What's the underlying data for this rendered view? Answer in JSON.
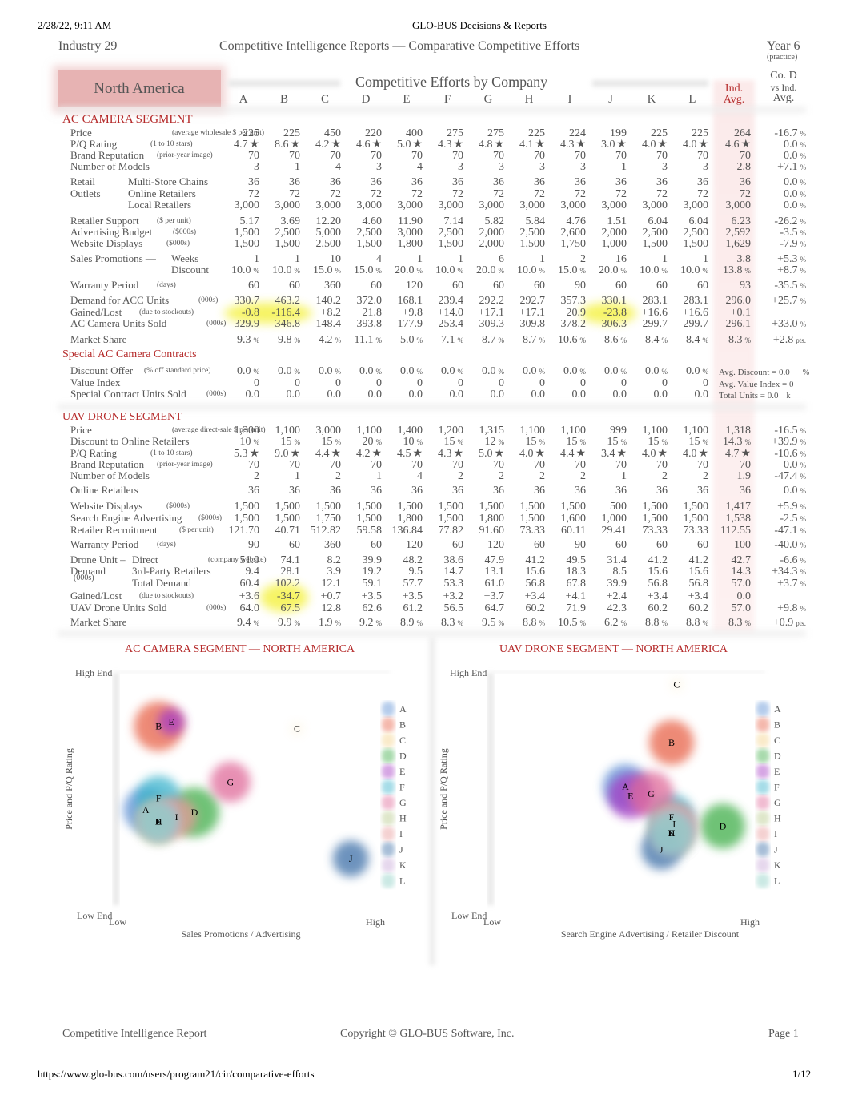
{
  "print_header": {
    "datetime": "2/28/22, 9:11 AM",
    "title": "GLO-BUS Decisions & Reports"
  },
  "report_header": {
    "industry": "Industry 29",
    "title": "Competitive Intelligence Reports — Comparative Competitive Efforts",
    "year": "Year 6",
    "year_note": "(practice)"
  },
  "region": "North America",
  "table_title": "Competitive Efforts by Company",
  "companies": [
    "A",
    "B",
    "C",
    "D",
    "E",
    "F",
    "G",
    "H",
    "I",
    "J",
    "K",
    "L"
  ],
  "avg_header": [
    "Ind.",
    "Avg."
  ],
  "diff_header": [
    "Co. D",
    "vs Ind.",
    "Avg."
  ],
  "ac_segment": {
    "title": "AC CAMERA SEGMENT",
    "rows": [
      {
        "label": "Price",
        "sub": "(average wholesale $ per unit)",
        "values": [
          "225",
          "225",
          "450",
          "220",
          "400",
          "275",
          "275",
          "225",
          "224",
          "199",
          "225",
          "225"
        ],
        "avg": "264",
        "diff": "-16.7",
        "diff_unit": "%"
      },
      {
        "label": "P/Q Rating",
        "sub": "(1 to 10 stars)",
        "values": [
          "4.7",
          "8.6",
          "4.2",
          "4.6",
          "5.0",
          "4.3",
          "4.8",
          "4.1",
          "4.3",
          "3.0",
          "4.0",
          "4.0"
        ],
        "value_suffix": "★",
        "avg": "4.6",
        "avg_suffix": "★",
        "diff": "0.0",
        "diff_unit": "%"
      },
      {
        "label": "Brand Reputation",
        "sub": "(prior-year image)",
        "values": [
          "70",
          "70",
          "70",
          "70",
          "70",
          "70",
          "70",
          "70",
          "70",
          "70",
          "70",
          "70"
        ],
        "avg": "70",
        "diff": "0.0",
        "diff_unit": "%"
      },
      {
        "label": "Number of Models",
        "sub": "",
        "values": [
          "3",
          "1",
          "4",
          "3",
          "4",
          "3",
          "3",
          "3",
          "3",
          "1",
          "3",
          "3"
        ],
        "avg": "2.8",
        "diff": "+7.1",
        "diff_unit": "%"
      },
      {
        "label": "Retail",
        "label2": "Multi-Store Chains",
        "values": [
          "36",
          "36",
          "36",
          "36",
          "36",
          "36",
          "36",
          "36",
          "36",
          "36",
          "36",
          "36"
        ],
        "avg": "36",
        "diff": "0.0",
        "diff_unit": "%"
      },
      {
        "label": "Outlets",
        "label2": "Online Retailers",
        "values": [
          "72",
          "72",
          "72",
          "72",
          "72",
          "72",
          "72",
          "72",
          "72",
          "72",
          "72",
          "72"
        ],
        "avg": "72",
        "diff": "0.0",
        "diff_unit": "%"
      },
      {
        "label": "",
        "label2": "Local Retailers",
        "values": [
          "3,000",
          "3,000",
          "3,000",
          "3,000",
          "3,000",
          "3,000",
          "3,000",
          "3,000",
          "3,000",
          "3,000",
          "3,000",
          "3,000"
        ],
        "avg": "3,000",
        "diff": "0.0",
        "diff_unit": "%"
      },
      {
        "label": "Retailer Support",
        "sub": "($ per unit)",
        "values": [
          "5.17",
          "3.69",
          "12.20",
          "4.60",
          "11.90",
          "7.14",
          "5.82",
          "5.84",
          "4.76",
          "1.51",
          "6.04",
          "6.04"
        ],
        "avg": "6.23",
        "diff": "-26.2",
        "diff_unit": "%"
      },
      {
        "label": "Advertising Budget",
        "sub": "($000s)",
        "values": [
          "1,500",
          "2,500",
          "5,000",
          "2,500",
          "3,000",
          "2,500",
          "2,000",
          "2,500",
          "2,600",
          "2,000",
          "2,500",
          "2,500"
        ],
        "avg": "2,592",
        "diff": "-3.5",
        "diff_unit": "%"
      },
      {
        "label": "Website Displays",
        "sub": "($000s)",
        "values": [
          "1,500",
          "1,500",
          "2,500",
          "1,500",
          "1,800",
          "1,500",
          "2,000",
          "1,500",
          "1,750",
          "1,000",
          "1,500",
          "1,500"
        ],
        "avg": "1,629",
        "diff": "-7.9",
        "diff_unit": "%"
      },
      {
        "label": "Sales Promotions —",
        "label2": "Weeks",
        "values": [
          "1",
          "1",
          "10",
          "4",
          "1",
          "1",
          "6",
          "1",
          "2",
          "16",
          "1",
          "1"
        ],
        "avg": "3.8",
        "diff": "+5.3",
        "diff_unit": "%"
      },
      {
        "label": "",
        "label2": "Discount",
        "values": [
          "10.0",
          "10.0",
          "15.0",
          "15.0",
          "20.0",
          "10.0",
          "20.0",
          "10.0",
          "15.0",
          "20.0",
          "10.0",
          "10.0"
        ],
        "value_unit": "%",
        "avg": "13.8",
        "avg_unit": "%",
        "diff": "+8.7",
        "diff_unit": "%"
      },
      {
        "label": "Warranty Period",
        "sub": "(days)",
        "values": [
          "60",
          "60",
          "360",
          "60",
          "120",
          "60",
          "60",
          "60",
          "90",
          "60",
          "60",
          "60"
        ],
        "avg": "93",
        "diff": "-35.5",
        "diff_unit": "%"
      },
      {
        "label": "Demand for ACC Units",
        "sub": "(000s)",
        "values": [
          "330.7",
          "463.2",
          "140.2",
          "372.0",
          "168.1",
          "239.4",
          "292.2",
          "292.7",
          "357.3",
          "330.1",
          "283.1",
          "283.1"
        ],
        "avg": "296.0",
        "diff": "+25.7",
        "diff_unit": "%"
      },
      {
        "label": "Gained/Lost",
        "sub": "(due to stockouts)",
        "values": [
          "-0.8",
          "-116.4",
          "+8.2",
          "+21.8",
          "+9.8",
          "+14.0",
          "+17.1",
          "+17.1",
          "+20.9",
          "-23.8",
          "+16.6",
          "+16.6"
        ],
        "avg": "+0.1",
        "diff": "",
        "diff_unit": ""
      },
      {
        "label": "AC Camera Units Sold",
        "sub": "(000s)",
        "values": [
          "329.9",
          "346.8",
          "148.4",
          "393.8",
          "177.9",
          "253.4",
          "309.3",
          "309.8",
          "378.2",
          "306.3",
          "299.7",
          "299.7"
        ],
        "avg": "296.1",
        "diff": "+33.0",
        "diff_unit": "%"
      },
      {
        "label": "Market Share",
        "sub": "",
        "values": [
          "9.3",
          "9.8",
          "4.2",
          "11.1",
          "5.0",
          "7.1",
          "8.7",
          "8.7",
          "10.6",
          "8.6",
          "8.4",
          "8.4"
        ],
        "value_unit": "%",
        "avg": "8.3",
        "avg_unit": "%",
        "diff": "+2.8",
        "diff_unit": "pts."
      }
    ],
    "highlighted_stockouts": [
      "A",
      "B",
      "J"
    ]
  },
  "special_contracts": {
    "title": "Special AC Camera Contracts",
    "rows": [
      {
        "label": "Discount Offer",
        "sub": "(% off standard price)",
        "values": [
          "0.0",
          "0.0",
          "0.0",
          "0.0",
          "0.0",
          "0.0",
          "0.0",
          "0.0",
          "0.0",
          "0.0",
          "0.0",
          "0.0"
        ],
        "value_unit": "%",
        "summary": "Avg. Discount = 0.0",
        "summary_unit": "%"
      },
      {
        "label": "Value Index",
        "sub": "",
        "values": [
          "0",
          "0",
          "0",
          "0",
          "0",
          "0",
          "0",
          "0",
          "0",
          "0",
          "0",
          "0"
        ],
        "summary": "Avg. Value Index = 0",
        "summary_unit": ""
      },
      {
        "label": "Special Contract Units Sold",
        "sub": "(000s)",
        "values": [
          "0.0",
          "0.0",
          "0.0",
          "0.0",
          "0.0",
          "0.0",
          "0.0",
          "0.0",
          "0.0",
          "0.0",
          "0.0",
          "0.0"
        ],
        "summary": "Total Units = 0.0",
        "summary_unit": "k"
      }
    ]
  },
  "uav_segment": {
    "title": "UAV DRONE SEGMENT",
    "rows": [
      {
        "label": "Price",
        "sub": "(average direct-sale $ per unit)",
        "values": [
          "1,300",
          "1,100",
          "3,000",
          "1,100",
          "1,400",
          "1,200",
          "1,315",
          "1,100",
          "1,100",
          "999",
          "1,100",
          "1,100"
        ],
        "avg": "1,318",
        "diff": "-16.5",
        "diff_unit": "%"
      },
      {
        "label": "Discount to Online Retailers",
        "sub": "",
        "values": [
          "10",
          "15",
          "15",
          "20",
          "10",
          "15",
          "12",
          "15",
          "15",
          "15",
          "15",
          "15"
        ],
        "value_unit": "%",
        "avg": "14.3",
        "avg_unit": "%",
        "diff": "+39.9",
        "diff_unit": "%"
      },
      {
        "label": "P/Q Rating",
        "sub": "(1 to 10 stars)",
        "values": [
          "5.3",
          "9.0",
          "4.4",
          "4.2",
          "4.5",
          "4.3",
          "5.0",
          "4.0",
          "4.4",
          "3.4",
          "4.0",
          "4.0"
        ],
        "value_suffix": "★",
        "avg": "4.7",
        "avg_suffix": "★",
        "diff": "-10.6",
        "diff_unit": "%"
      },
      {
        "label": "Brand Reputation",
        "sub": "(prior-year image)",
        "values": [
          "70",
          "70",
          "70",
          "70",
          "70",
          "70",
          "70",
          "70",
          "70",
          "70",
          "70",
          "70"
        ],
        "avg": "70",
        "diff": "0.0",
        "diff_unit": "%"
      },
      {
        "label": "Number of Models",
        "sub": "",
        "values": [
          "2",
          "1",
          "2",
          "1",
          "4",
          "2",
          "2",
          "2",
          "2",
          "1",
          "2",
          "2"
        ],
        "avg": "1.9",
        "diff": "-47.4",
        "diff_unit": "%"
      },
      {
        "label": "Online Retailers",
        "sub": "",
        "values": [
          "36",
          "36",
          "36",
          "36",
          "36",
          "36",
          "36",
          "36",
          "36",
          "36",
          "36",
          "36"
        ],
        "avg": "36",
        "diff": "0.0",
        "diff_unit": "%"
      },
      {
        "label": "Website Displays",
        "sub": "($000s)",
        "values": [
          "1,500",
          "1,500",
          "1,500",
          "1,500",
          "1,500",
          "1,500",
          "1,500",
          "1,500",
          "1,500",
          "500",
          "1,500",
          "1,500"
        ],
        "avg": "1,417",
        "diff": "+5.9",
        "diff_unit": "%"
      },
      {
        "label": "Search Engine Advertising",
        "sub": "($000s)",
        "values": [
          "1,500",
          "1,500",
          "1,750",
          "1,500",
          "1,800",
          "1,500",
          "1,800",
          "1,500",
          "1,600",
          "1,000",
          "1,500",
          "1,500"
        ],
        "avg": "1,538",
        "diff": "-2.5",
        "diff_unit": "%"
      },
      {
        "label": "Retailer Recruitment",
        "sub": "($ per unit)",
        "values": [
          "121.70",
          "40.71",
          "512.82",
          "59.58",
          "136.84",
          "77.82",
          "91.60",
          "73.33",
          "60.11",
          "29.41",
          "73.33",
          "73.33"
        ],
        "avg": "112.55",
        "diff": "-47.1",
        "diff_unit": "%"
      },
      {
        "label": "Warranty Period",
        "sub": "(days)",
        "values": [
          "90",
          "60",
          "360",
          "60",
          "120",
          "60",
          "120",
          "60",
          "90",
          "60",
          "60",
          "60"
        ],
        "avg": "100",
        "diff": "-40.0",
        "diff_unit": "%"
      },
      {
        "label": "Drone Unit –",
        "label2": "Direct",
        "sub": "(company website)",
        "values": [
          "51.0",
          "74.1",
          "8.2",
          "39.9",
          "48.2",
          "38.6",
          "47.9",
          "41.2",
          "49.5",
          "31.4",
          "41.2",
          "41.2"
        ],
        "avg": "42.7",
        "diff": "-6.6",
        "diff_unit": "%"
      },
      {
        "label": "Demand",
        "label2": "3rd-Party Retailers",
        "sub": "",
        "values": [
          "9.4",
          "28.1",
          "3.9",
          "19.2",
          "9.5",
          "14.7",
          "13.1",
          "15.6",
          "18.3",
          "8.5",
          "15.6",
          "15.6"
        ],
        "avg": "14.3",
        "diff": "+34.3",
        "diff_unit": "%"
      },
      {
        "label": "(000s)",
        "label2": "Total Demand",
        "sub": "",
        "values": [
          "60.4",
          "102.2",
          "12.1",
          "59.1",
          "57.7",
          "53.3",
          "61.0",
          "56.8",
          "67.8",
          "39.9",
          "56.8",
          "56.8"
        ],
        "avg": "57.0",
        "diff": "+3.7",
        "diff_unit": "%"
      },
      {
        "label": "Gained/Lost",
        "sub": "(due to stockouts)",
        "values": [
          "+3.6",
          "-34.7",
          "+0.7",
          "+3.5",
          "+3.5",
          "+3.2",
          "+3.7",
          "+3.4",
          "+4.1",
          "+2.4",
          "+3.4",
          "+3.4"
        ],
        "avg": "0.0",
        "diff": "",
        "diff_unit": ""
      },
      {
        "label": "UAV Drone Units Sold",
        "sub": "(000s)",
        "values": [
          "64.0",
          "67.5",
          "12.8",
          "62.6",
          "61.2",
          "56.5",
          "64.7",
          "60.2",
          "71.9",
          "42.3",
          "60.2",
          "60.2"
        ],
        "avg": "57.0",
        "diff": "+9.8",
        "diff_unit": "%"
      },
      {
        "label": "Market Share",
        "sub": "",
        "values": [
          "9.4",
          "9.9",
          "1.9",
          "9.2",
          "8.9",
          "8.3",
          "9.5",
          "8.8",
          "10.5",
          "6.2",
          "8.8",
          "8.8"
        ],
        "value_unit": "%",
        "avg": "8.3",
        "avg_unit": "%",
        "diff": "+0.9",
        "diff_unit": "pts."
      }
    ],
    "highlighted_stockouts": [
      "B"
    ]
  },
  "company_colors": {
    "A": "#5b8fd4",
    "B": "#e8644a",
    "C": "#f4d28a",
    "D": "#3fae49",
    "E": "#a53bc4",
    "F": "#3bb3cc",
    "G": "#e06a9a",
    "H": "#b7c98a",
    "I": "#e89a9a",
    "J": "#3d6fa8",
    "K": "#c8a8d8",
    "L": "#8ccfc4"
  },
  "chart_data": [
    {
      "type": "scatter",
      "title": "AC CAMERA SEGMENT — NORTH AMERICA",
      "xlabel": "Sales Promotions / Advertising",
      "ylabel": "Price and P/Q Rating",
      "x_tick_labels": [
        "Low",
        "High"
      ],
      "y_tick_labels": [
        "Low End",
        "High End"
      ],
      "xlim": [
        0,
        100
      ],
      "ylim": [
        0,
        100
      ],
      "legend": [
        "A",
        "B",
        "C",
        "D",
        "E",
        "F",
        "G",
        "H",
        "I",
        "J",
        "K",
        "L"
      ],
      "legend_position": "right",
      "points": [
        {
          "label": "A",
          "x": 11,
          "y": 41,
          "size": 1.0
        },
        {
          "label": "B",
          "x": 16,
          "y": 77,
          "size": 1.1
        },
        {
          "label": "C",
          "x": 70,
          "y": 76,
          "size": 0.3
        },
        {
          "label": "D",
          "x": 30,
          "y": 40,
          "size": 1.1
        },
        {
          "label": "E",
          "x": 21,
          "y": 79,
          "size": 0.6
        },
        {
          "label": "F",
          "x": 16,
          "y": 46,
          "size": 1.0
        },
        {
          "label": "G",
          "x": 44,
          "y": 53,
          "size": 0.9
        },
        {
          "label": "H",
          "x": 16,
          "y": 36,
          "size": 1.0
        },
        {
          "label": "I",
          "x": 23,
          "y": 38,
          "size": 0.9
        },
        {
          "label": "J",
          "x": 91,
          "y": 20,
          "size": 0.8
        },
        {
          "label": "K",
          "x": 16,
          "y": 36,
          "size": 0.9
        },
        {
          "label": "L",
          "x": 16,
          "y": 36,
          "size": 0.9
        }
      ]
    },
    {
      "type": "scatter",
      "title": "UAV DRONE SEGMENT — NORTH AMERICA",
      "xlabel": "Search Engine Advertising / Retailer Discount",
      "ylabel": "Price and P/Q Rating",
      "x_tick_labels": [
        "Low",
        "High"
      ],
      "y_tick_labels": [
        "Low End",
        "High End"
      ],
      "xlim": [
        0,
        100
      ],
      "ylim": [
        0,
        100
      ],
      "legend": [
        "A",
        "B",
        "C",
        "D",
        "E",
        "F",
        "G",
        "H",
        "I",
        "J",
        "K",
        "L"
      ],
      "legend_position": "right",
      "points": [
        {
          "label": "A",
          "x": 52,
          "y": 51,
          "size": 1.0
        },
        {
          "label": "B",
          "x": 70,
          "y": 70,
          "size": 1.0
        },
        {
          "label": "C",
          "x": 72,
          "y": 95,
          "size": 0.3
        },
        {
          "label": "D",
          "x": 90,
          "y": 34,
          "size": 1.0
        },
        {
          "label": "E",
          "x": 54,
          "y": 47,
          "size": 1.0
        },
        {
          "label": "F",
          "x": 70,
          "y": 38,
          "size": 1.0
        },
        {
          "label": "G",
          "x": 62,
          "y": 48,
          "size": 1.0
        },
        {
          "label": "H",
          "x": 70,
          "y": 31,
          "size": 1.0
        },
        {
          "label": "I",
          "x": 71,
          "y": 35,
          "size": 1.0
        },
        {
          "label": "J",
          "x": 66,
          "y": 24,
          "size": 0.9
        },
        {
          "label": "K",
          "x": 70,
          "y": 31,
          "size": 1.0
        },
        {
          "label": "L",
          "x": 70,
          "y": 31,
          "size": 1.0
        }
      ]
    }
  ],
  "footer": {
    "left": "Competitive Intelligence Report",
    "center": "Copyright © GLO-BUS Software, Inc.",
    "right": "Page 1"
  },
  "print_footer": {
    "url": "https://www.glo-bus.com/users/program21/cir/comparative-efforts",
    "page": "1/12"
  }
}
